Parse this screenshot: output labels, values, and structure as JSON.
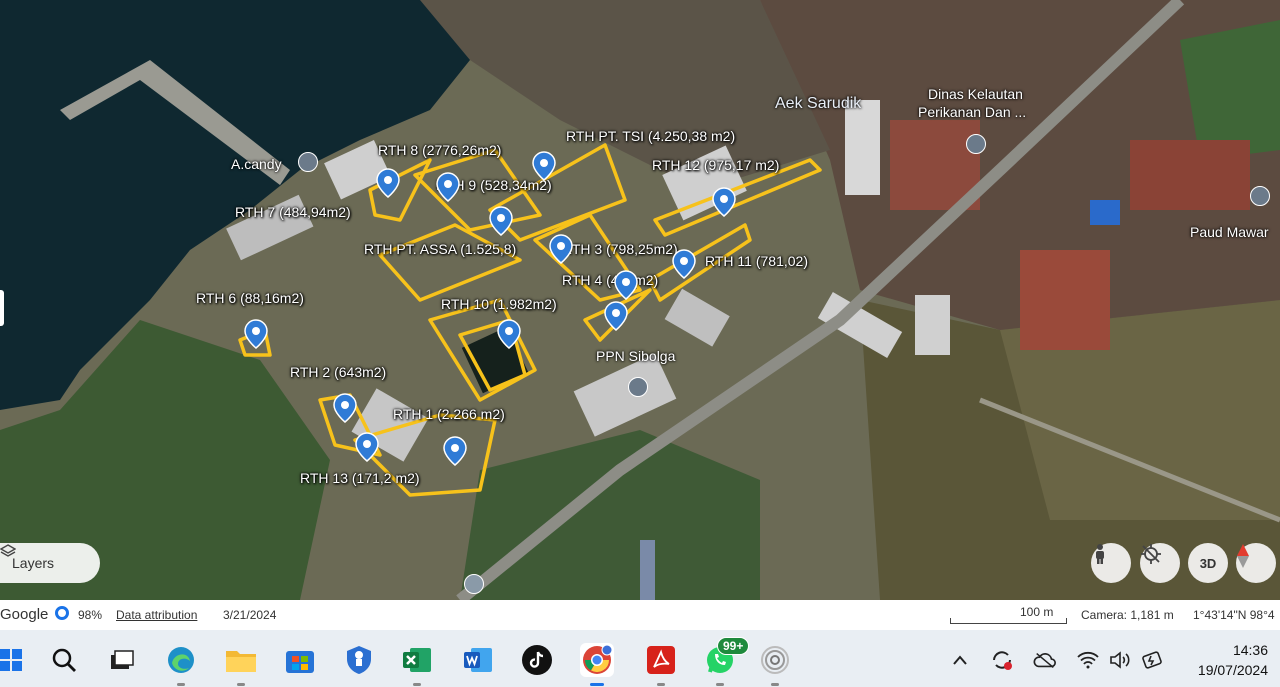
{
  "labels": {
    "rth1": "RTH 1 (2.266 m2)",
    "rth2": "RTH 2 (643m2)",
    "rth3": "RTH 3 (798,25m2)",
    "rth4": "RTH 4 (441m2)",
    "rth6": "RTH 6 (88,16m2)",
    "rth7": "RTH 7 (484,94m2)",
    "rth8": "RTH 8 (2776,26m2)",
    "rth9": "RTH 9 (528,34m2)",
    "rth10": "RTH 10  (1.982m2)",
    "rth11": "RTH 11 (781,02)",
    "rth12": "RTH 12 (975,17 m2)",
    "rth13": "RTH 13 (171,2 m2)",
    "rth_assa": "RTH PT. ASSA (1.525,8)",
    "rth_tsi": "RTH PT. TSI (4.250,38 m2)"
  },
  "places": {
    "a_candy": "A.candy",
    "aek_sarudik": "Aek Sarudik",
    "dinas_line1": "Dinas Kelautan",
    "dinas_line2": "Perikanan Dan ...",
    "ppn_sibolga": "PPN Sibolga",
    "paud_mawar": "Paud Mawar"
  },
  "controls": {
    "layers_label": "Layers",
    "threed_label": "3D"
  },
  "footer": {
    "brand": "Google",
    "percent": "98%",
    "attribution": "Data attribution",
    "date": "3/21/2024",
    "scale": "100 m",
    "camera": "Camera: 1,181 m",
    "coords": "1°43'14\"N 98°4"
  },
  "taskbar": {
    "whatsapp_badge": "99+",
    "time": "14:36",
    "date": "19/07/2024"
  },
  "colors": {
    "polygon": "#f7c21b",
    "pin": "#2f7bd6",
    "sea": "#0f2830"
  }
}
